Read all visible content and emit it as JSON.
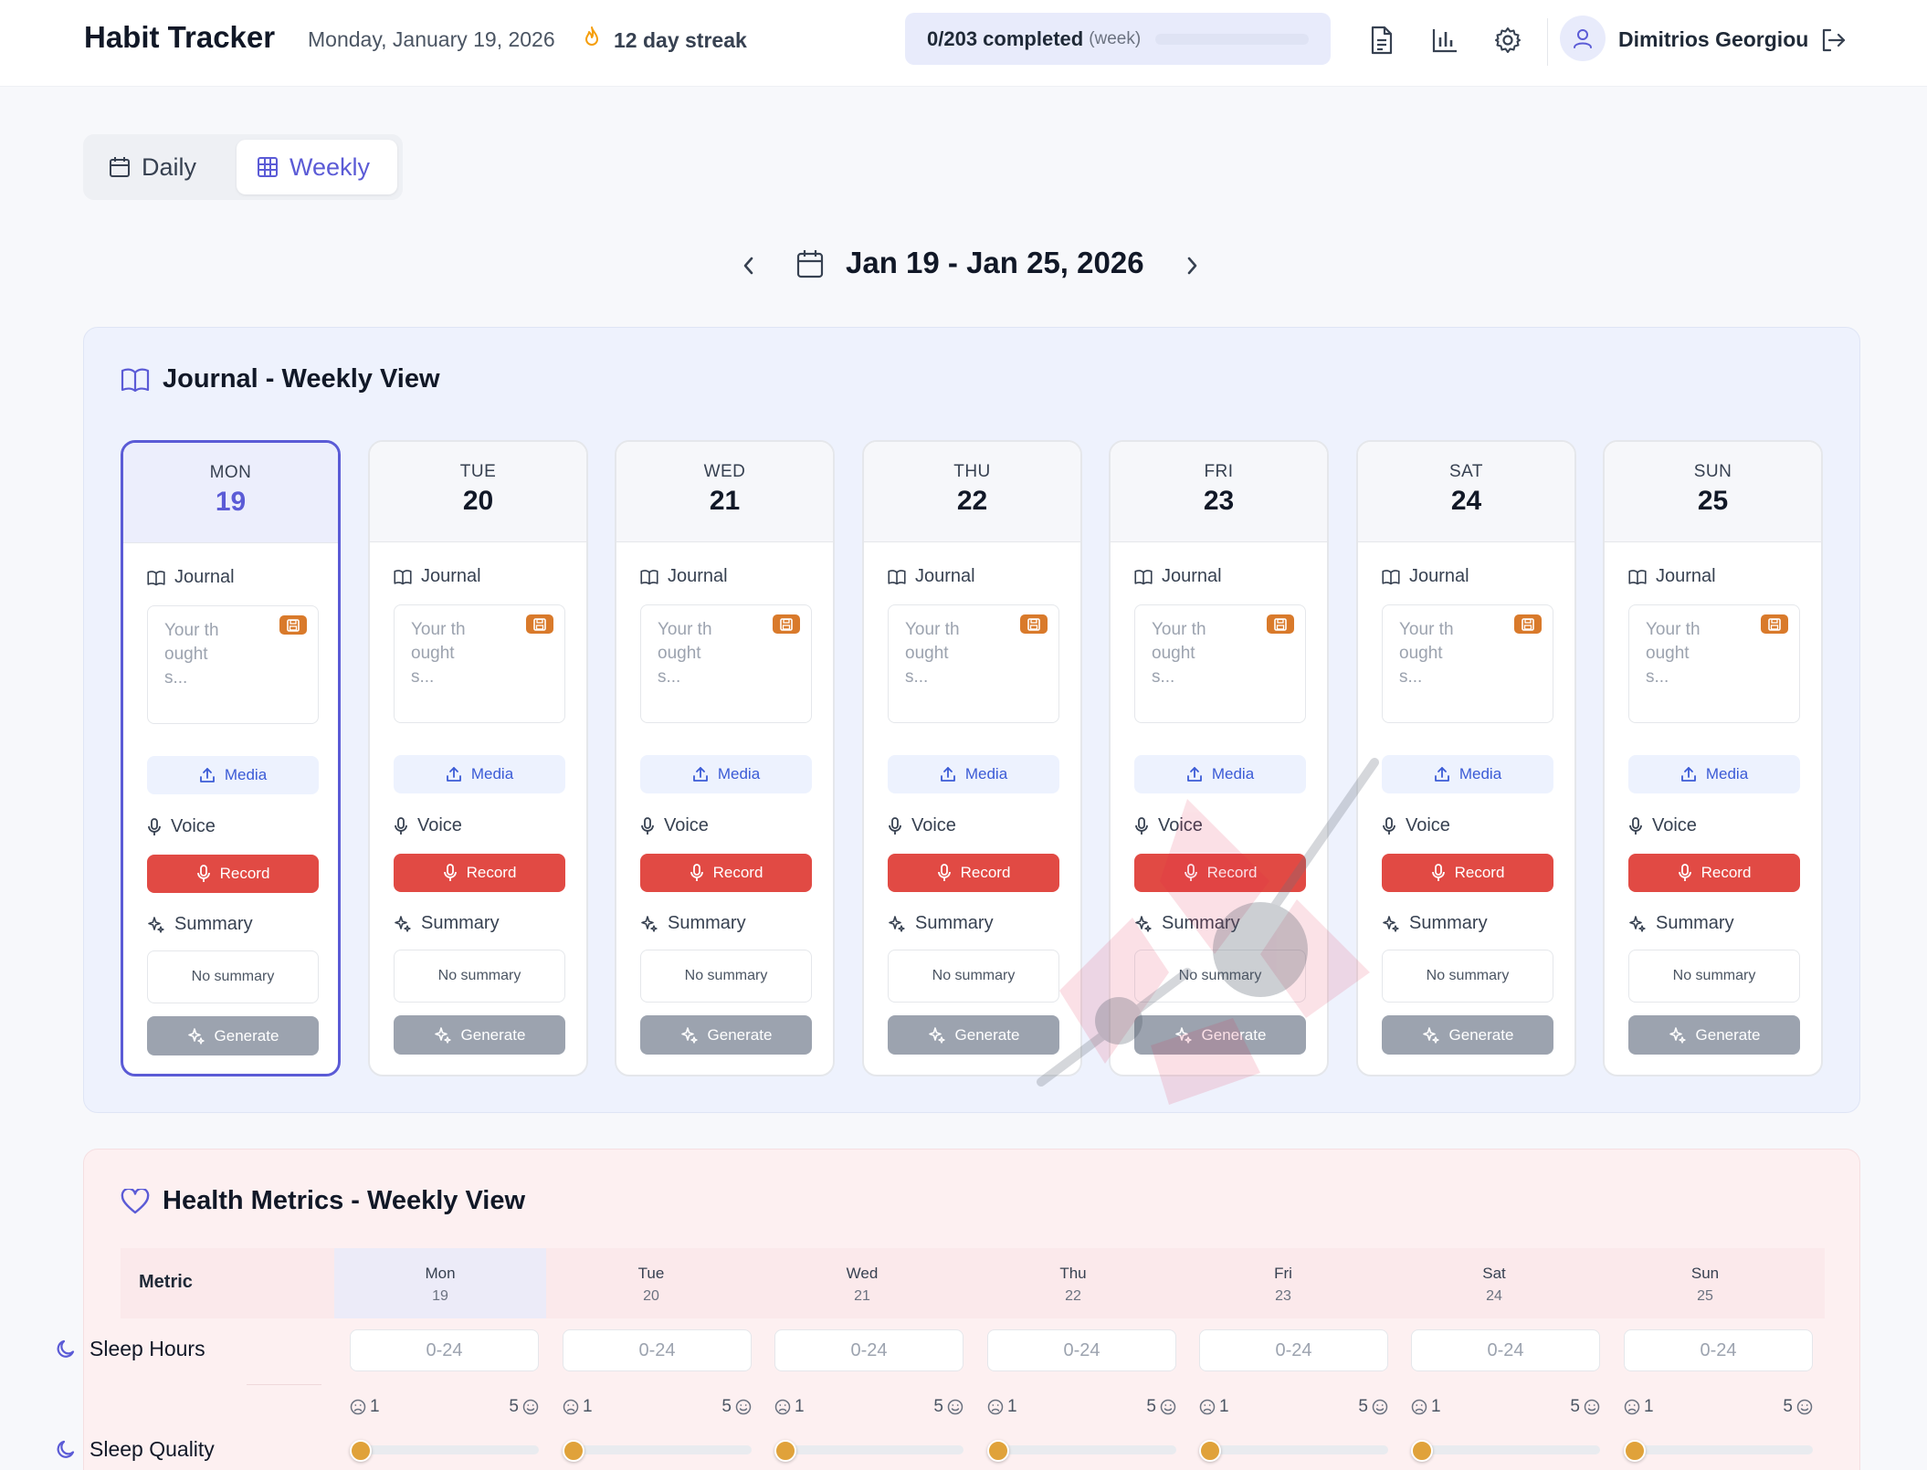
{
  "header": {
    "app_title": "Habit Tracker",
    "date": "Monday, January 19, 2026",
    "streak": "12 day streak",
    "progress_text": "0/203 completed",
    "progress_sub": "(week)",
    "progress_fraction": 0,
    "user_name": "Dimitrios Georgiou"
  },
  "view_toggle": {
    "daily_label": "Daily",
    "weekly_label": "Weekly",
    "active": "weekly"
  },
  "week_nav": {
    "range": "Jan 19 - Jan 25, 2026"
  },
  "journal": {
    "title": "Journal - Weekly View",
    "journal_label": "Journal",
    "placeholder": "Your thoughts...",
    "media_label": "Media",
    "voice_label": "Voice",
    "record_label": "Record",
    "summary_label": "Summary",
    "no_summary": "No summary",
    "generate_label": "Generate",
    "days": [
      {
        "dow": "MON",
        "num": "19",
        "selected": true
      },
      {
        "dow": "TUE",
        "num": "20",
        "selected": false
      },
      {
        "dow": "WED",
        "num": "21",
        "selected": false
      },
      {
        "dow": "THU",
        "num": "22",
        "selected": false
      },
      {
        "dow": "FRI",
        "num": "23",
        "selected": false
      },
      {
        "dow": "SAT",
        "num": "24",
        "selected": false
      },
      {
        "dow": "SUN",
        "num": "25",
        "selected": false
      }
    ]
  },
  "health": {
    "title": "Health Metrics - Weekly View",
    "metric_col": "Metric",
    "days": [
      {
        "day": "Mon",
        "num": "19",
        "selected": true
      },
      {
        "day": "Tue",
        "num": "20",
        "selected": false
      },
      {
        "day": "Wed",
        "num": "21",
        "selected": false
      },
      {
        "day": "Thu",
        "num": "22",
        "selected": false
      },
      {
        "day": "Fri",
        "num": "23",
        "selected": false
      },
      {
        "day": "Sat",
        "num": "24",
        "selected": false
      },
      {
        "day": "Sun",
        "num": "25",
        "selected": false
      }
    ],
    "sleep_hours_label": "Sleep Hours",
    "sleep_hours_placeholder": "0-24",
    "sleep_quality_label": "Sleep Quality",
    "scale_min": "1",
    "scale_max": "5",
    "sleep_quality_values": [
      1,
      1,
      1,
      1,
      1,
      1,
      1
    ]
  },
  "colors": {
    "accent": "#5b5bd6",
    "record": "#e14a44",
    "save_badge": "#d97a2b",
    "slider_thumb": "#e0a23a"
  }
}
